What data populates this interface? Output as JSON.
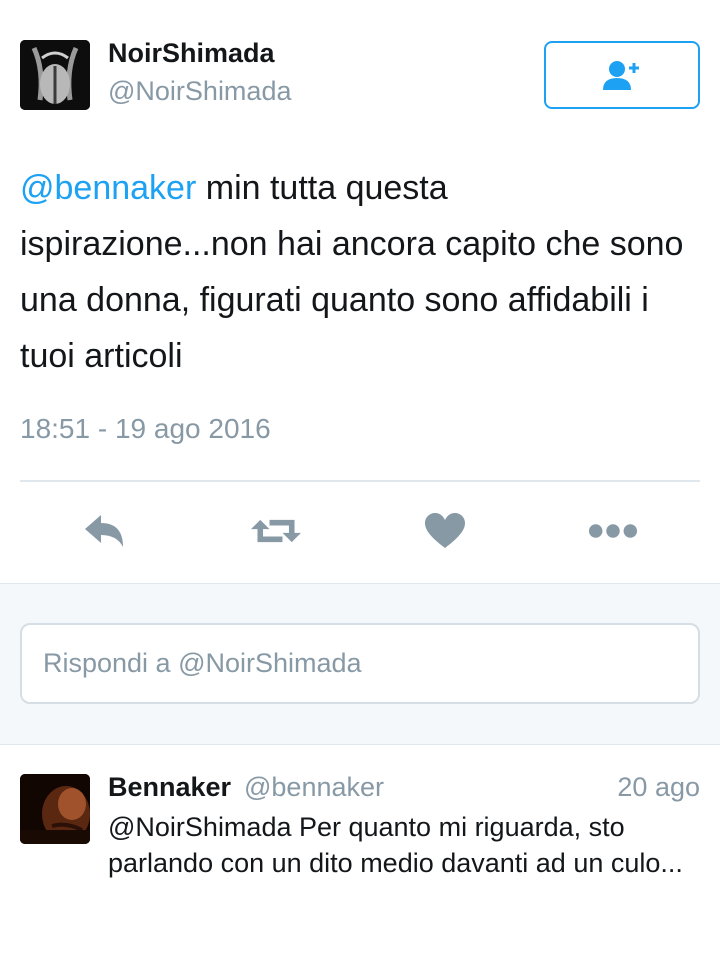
{
  "tweet": {
    "author_name": "NoirShimada",
    "author_handle": "@NoirShimada",
    "mention": "@bennaker",
    "text": " min tutta questa ispirazione...non hai ancora capito che sono una donna, figurati quanto sono affidabili i tuoi articoli",
    "timestamp": "18:51 - 19 ago 2016"
  },
  "icons": {
    "follow": "add-user-icon",
    "reply": "reply-icon",
    "retweet": "retweet-icon",
    "like": "heart-icon",
    "more": "more-icon"
  },
  "reply_box": {
    "placeholder": "Rispondi a @NoirShimada"
  },
  "reply": {
    "author_name": "Bennaker",
    "author_handle": "@bennaker",
    "date": "20 ago",
    "text": "@NoirShimada Per quanto mi riguarda, sto parlando con un dito medio davanti ad un culo..."
  },
  "colors": {
    "accent": "#1da1f2",
    "icon_gray": "#8899a6",
    "text": "#14171a"
  }
}
